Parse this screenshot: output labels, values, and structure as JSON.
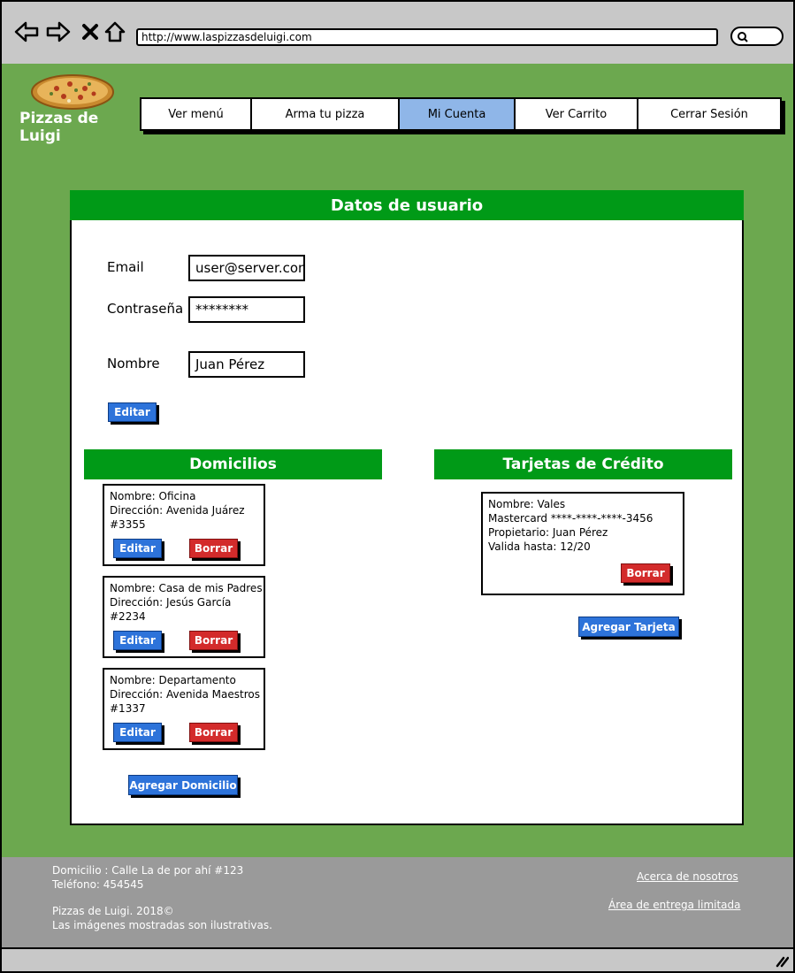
{
  "browser": {
    "url": "http://www.laspizzasdeluigi.com"
  },
  "brand": {
    "name": "Pizzas de Luigi"
  },
  "nav": {
    "items": [
      {
        "label": "Ver menú"
      },
      {
        "label": "Arma tu pizza"
      },
      {
        "label": "Mi Cuenta",
        "active": true
      },
      {
        "label": "Ver Carrito"
      },
      {
        "label": "Cerrar Sesión"
      }
    ]
  },
  "user": {
    "title": "Datos de usuario",
    "email_label": "Email",
    "email_value": "user@server.com",
    "password_label": "Contraseña",
    "password_value": "********",
    "name_label": "Nombre",
    "name_value": "Juan Pérez",
    "edit_label": "Editar"
  },
  "addresses": {
    "title": "Domicilios",
    "items": [
      {
        "name": "Nombre: Oficina",
        "address": "Dirección: Avenida Juárez",
        "number": "#3355"
      },
      {
        "name": "Nombre: Casa de mis Padres",
        "address": "Dirección: Jesús García",
        "number": "#2234"
      },
      {
        "name": "Nombre: Departamento",
        "address": "Dirección: Avenida Maestros",
        "number": "#1337"
      }
    ],
    "edit_label": "Editar",
    "delete_label": "Borrar",
    "add_label": "Agregar Domicilio"
  },
  "cards": {
    "title": "Tarjetas de Crédito",
    "items": [
      {
        "name": "Nombre: Vales",
        "number": "Mastercard ****-****-****-3456",
        "owner": "Propietario: Juan Pérez",
        "expiry": "Valida hasta: 12/20"
      }
    ],
    "delete_label": "Borrar",
    "add_label": "Agregar Tarjeta"
  },
  "footer": {
    "address": "Domicilio : Calle La de por ahí #123",
    "phone": "Teléfono: 454545",
    "copyright": "Pizzas de Luigi. 2018©",
    "disclaimer": "Las imágenes mostradas son ilustrativas.",
    "about_link": "Acerca de nosotros",
    "delivery_link": "Área de entrega limitada"
  },
  "colors": {
    "page_bg": "#6ca84f",
    "section_header": "#009a17",
    "nav_active": "#8fb6e8",
    "button_blue": "#2d73da",
    "button_red": "#d32b2b"
  }
}
